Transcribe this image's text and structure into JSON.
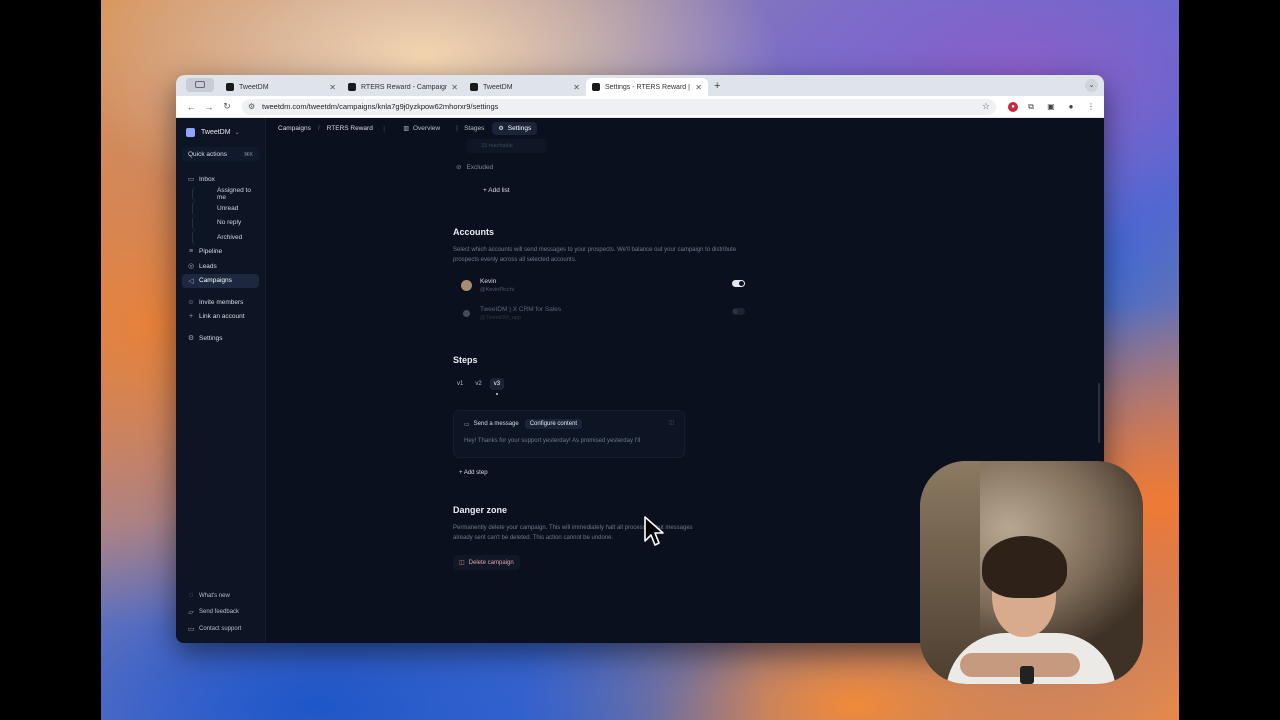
{
  "browser": {
    "tabs": [
      {
        "label": "TweetDM",
        "active": false
      },
      {
        "label": "RTERS Reward - Campaigns",
        "active": false
      },
      {
        "label": "TweetDM",
        "active": false
      },
      {
        "label": "Settings - RTERS Reward | T",
        "active": true
      }
    ],
    "url": "tweetdm.com/tweetdm/campaigns/knla7g9j0yzkpow62mhorxr9/settings"
  },
  "sidebar": {
    "workspace": "TweetDM",
    "quick_actions": "Quick actions",
    "quick_kbd": "⌘K",
    "items": [
      {
        "label": "Inbox",
        "icon": "inbox-icon"
      },
      {
        "label": "Assigned to me",
        "sub": true
      },
      {
        "label": "Unread",
        "sub": true
      },
      {
        "label": "No reply",
        "sub": true
      },
      {
        "label": "Archived",
        "sub": true
      },
      {
        "label": "Pipeline",
        "icon": "pipeline-icon"
      },
      {
        "label": "Leads",
        "icon": "leads-icon"
      },
      {
        "label": "Campaigns",
        "icon": "campaigns-icon",
        "active": true
      },
      {
        "label": "Invite members",
        "icon": "user-icon"
      },
      {
        "label": "Link an account",
        "icon": "plus-icon"
      },
      {
        "label": "Settings",
        "icon": "gear-icon"
      }
    ],
    "footer": [
      "What's new",
      "Send feedback",
      "Contact support"
    ]
  },
  "topbar": {
    "crumbs": [
      "Campaigns",
      "RTERS Reward"
    ],
    "tabs": [
      {
        "label": "Overview",
        "icon": "chart-icon"
      },
      {
        "label": "Stages",
        "icon": "stages-icon"
      },
      {
        "label": "Settings",
        "icon": "gear-icon",
        "active": true
      }
    ]
  },
  "content": {
    "reachable": "33 reachable",
    "excluded": "Excluded",
    "add_list": "Add list",
    "accounts_title": "Accounts",
    "accounts_desc": "Select which accounts will send messages to your prospects. We'll balance out your campaign to distribute prospects evenly across all selected accounts.",
    "accounts": [
      {
        "name": "Kevin",
        "handle": "@KevinPicchi",
        "enabled": true
      },
      {
        "name": "TweetDM | X CRM for Sales",
        "handle": "@TweetDM_app",
        "enabled": false
      }
    ],
    "steps_title": "Steps",
    "versions": [
      "v1",
      "v2",
      "v3"
    ],
    "step": {
      "type": "Send a message",
      "configure": "Configure content",
      "body": "Hey! Thanks for your support yesterday! As promised yesterday I'll"
    },
    "add_step": "Add step",
    "danger_title": "Danger zone",
    "danger_desc": "Permanently delete your campaign. This will immediately halt all processes, but messages already sent can't be deleted. This action cannot be undone.",
    "delete_label": "Delete campaign"
  },
  "colors": {
    "accent": "#8fa6ff",
    "background": "#0a101d",
    "sidebar": "#0d1424"
  }
}
